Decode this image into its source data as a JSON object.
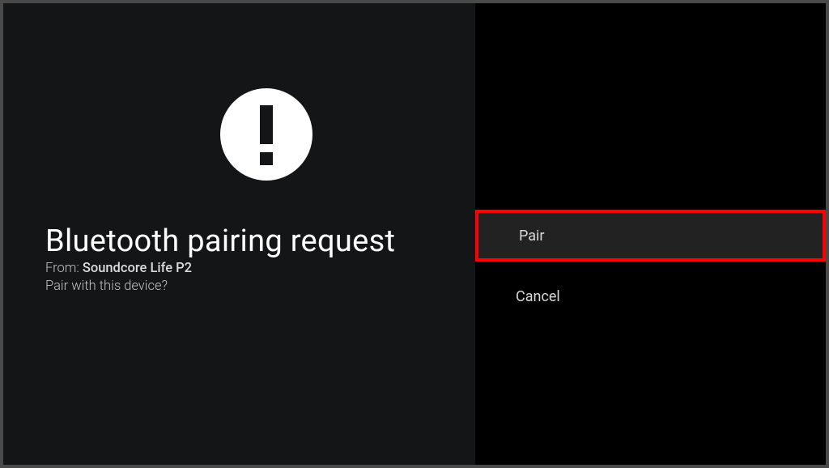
{
  "dialog": {
    "title": "Bluetooth pairing request",
    "from_label": "From: ",
    "device_name": "Soundcore Life P2",
    "prompt": "Pair with this device?"
  },
  "actions": {
    "pair_label": "Pair",
    "cancel_label": "Cancel"
  }
}
